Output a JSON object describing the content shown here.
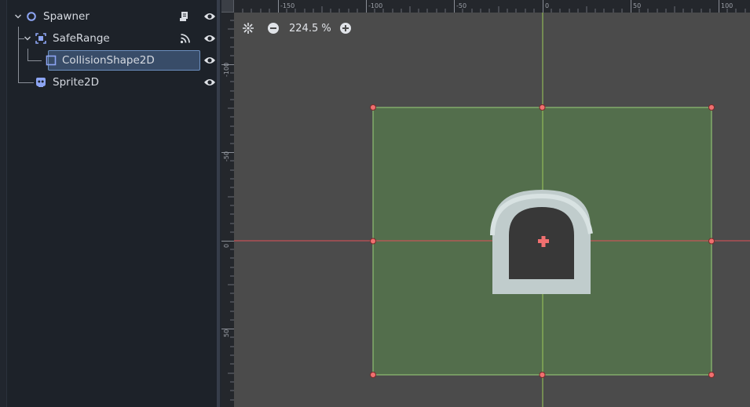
{
  "scene_tree": {
    "nodes": [
      {
        "name": "Spawner",
        "icon": "node2d-icon",
        "aux_icon": "script-icon",
        "visible": true
      },
      {
        "name": "SafeRange",
        "icon": "area2d-icon",
        "aux_icon": "signal-icon",
        "visible": true
      },
      {
        "name": "CollisionShape2D",
        "icon": "collision-shape-icon",
        "selected": true,
        "visible": true
      },
      {
        "name": "Sprite2D",
        "icon": "sprite2d-icon",
        "visible": true
      }
    ]
  },
  "viewport": {
    "zoom_label": "224.5 %",
    "ruler_top": [
      "-150",
      "-100",
      "-50",
      "0",
      "50",
      "100"
    ],
    "ruler_left": [
      "-100",
      "-50",
      "0",
      "50"
    ],
    "colors": {
      "background": "#4b4b4b",
      "collision_fill": "#536e4c",
      "collision_outline": "#9bd17a",
      "handle": "#f07070",
      "x_axis": "#e0505a",
      "y_axis": "#9ccb5a"
    }
  }
}
